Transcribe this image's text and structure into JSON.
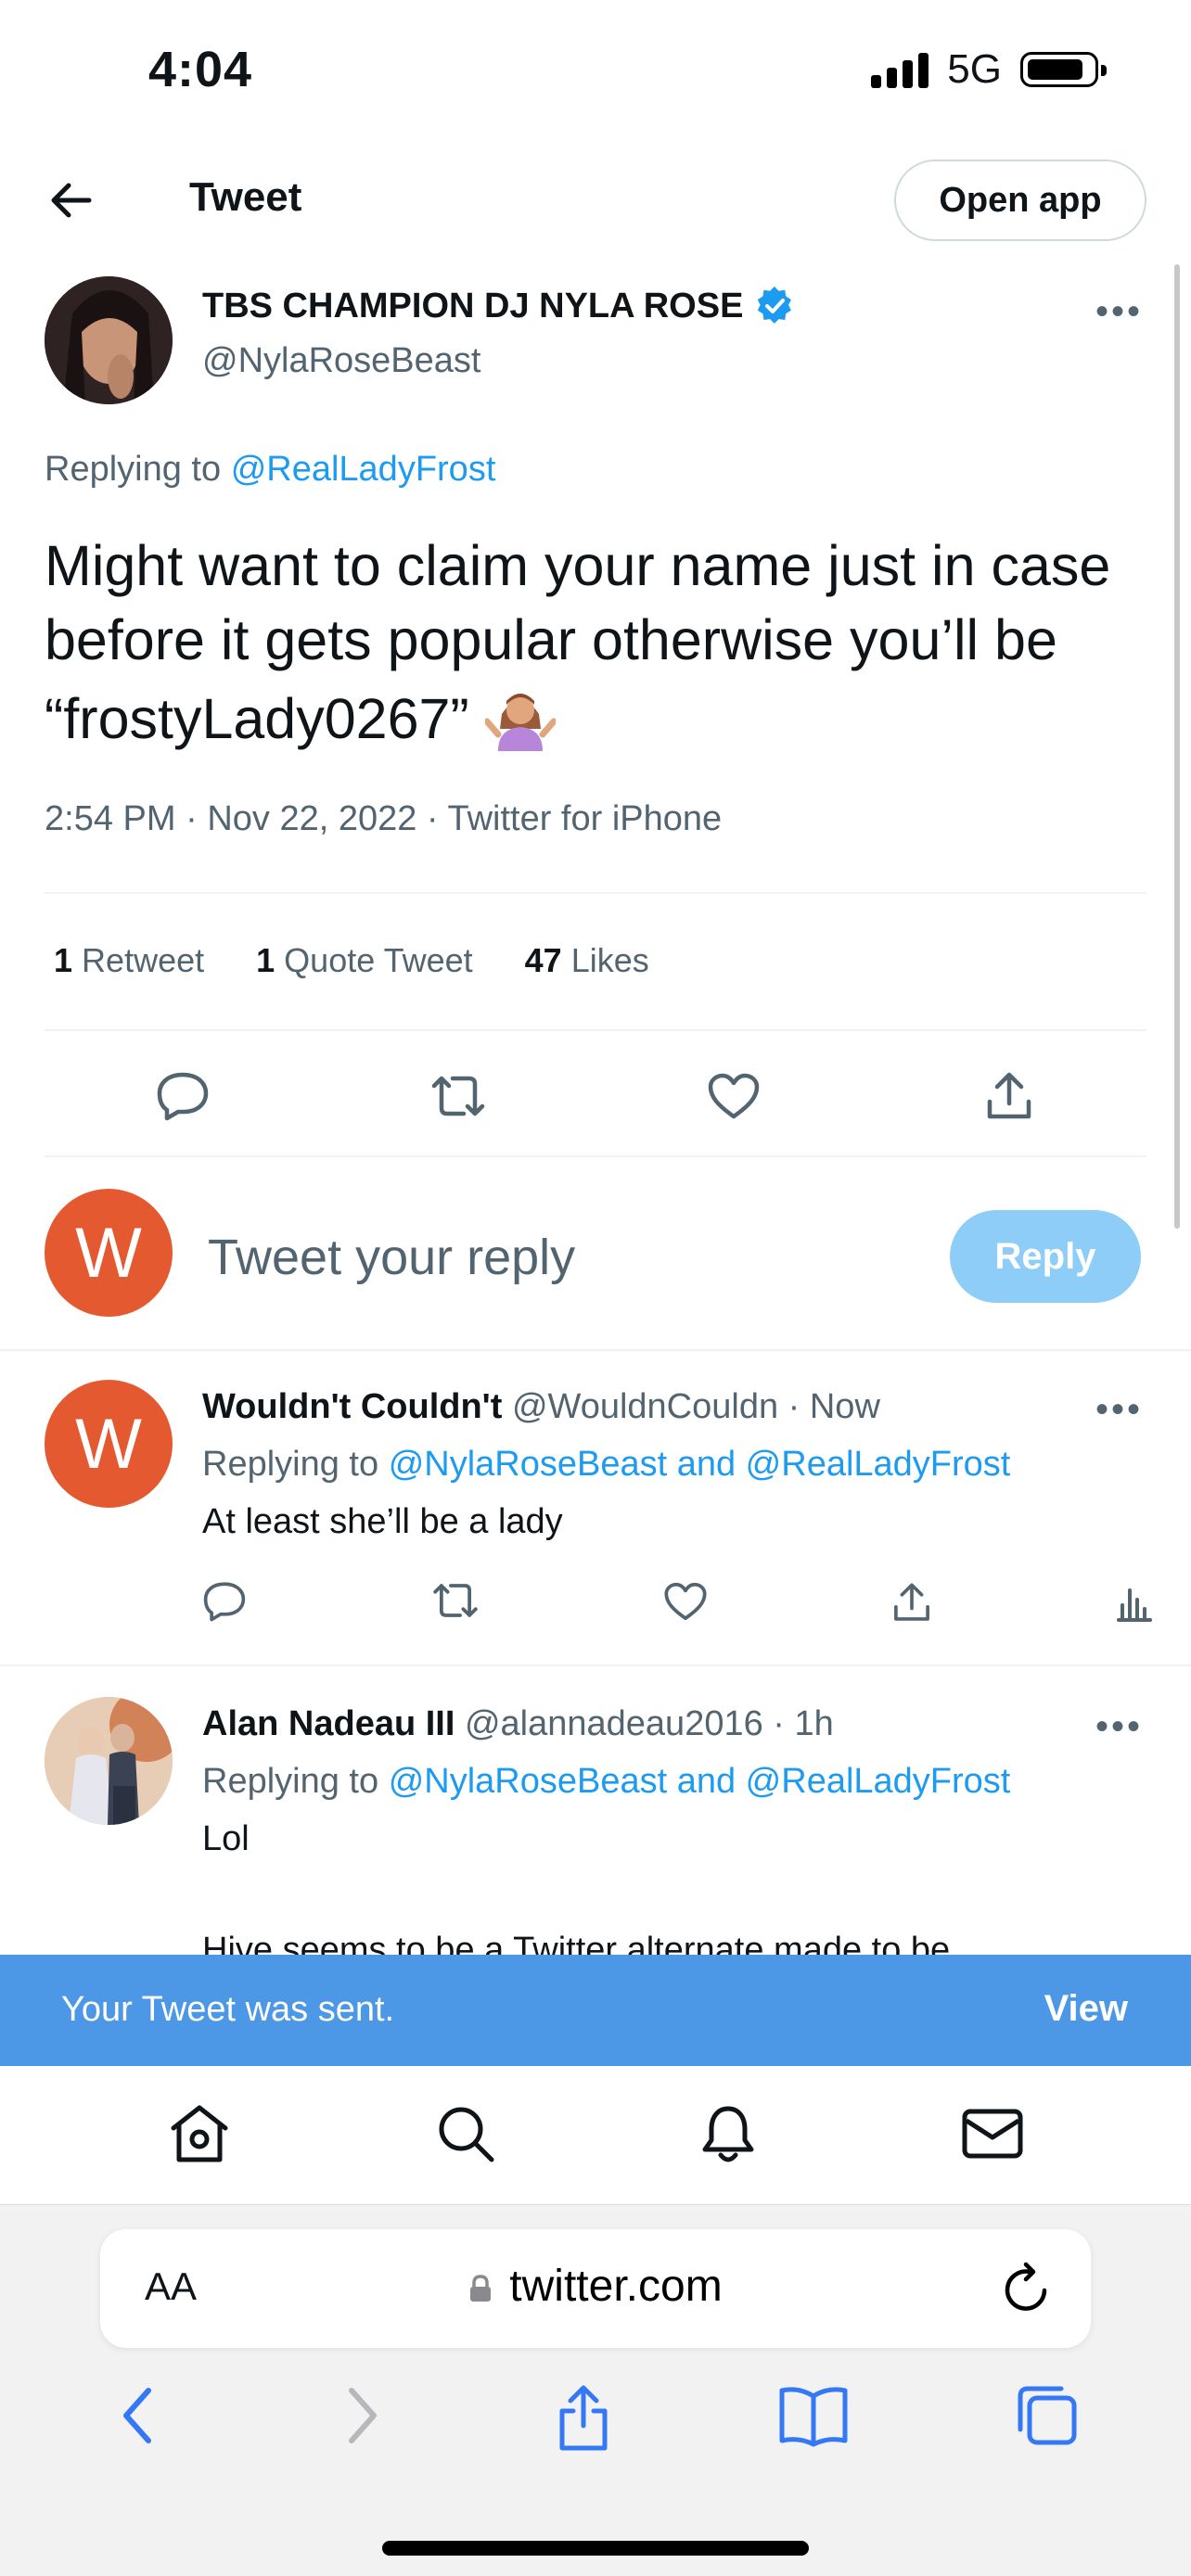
{
  "status_bar": {
    "time": "4:04",
    "network": "5G"
  },
  "header": {
    "title": "Tweet",
    "open_app_label": "Open app"
  },
  "tweet": {
    "display_name": "TBS CHAMPION DJ NYLA ROSE",
    "handle": "@NylaRoseBeast",
    "replying_prefix": "Replying to",
    "replying_to": "@RealLadyFrost",
    "text": "Might want to claim your name just in case before it gets popular otherwise you’ll be “frostyLady0267”",
    "emoji": "person-shrugging-emoji",
    "time": "2:54 PM",
    "date": "Nov 22, 2022",
    "source": "Twitter for iPhone",
    "retweet_count": "1",
    "retweet_label": "Retweet",
    "quote_count": "1",
    "quote_label": "Quote Tweet",
    "likes_count": "47",
    "likes_label": "Likes"
  },
  "compose": {
    "avatar_letter": "W",
    "placeholder": "Tweet your reply",
    "reply_label": "Reply"
  },
  "replies": [
    {
      "avatar_letter": "W",
      "name": "Wouldn't Couldn't",
      "handle": "@WouldnCouldn",
      "time": "· Now",
      "replying_prefix": "Replying to",
      "replying_to": "@NylaRoseBeast and @RealLadyFrost",
      "text": "At least she’ll be a lady"
    },
    {
      "name": "Alan Nadeau III",
      "handle": "@alannadeau2016",
      "time": "· 1h",
      "replying_prefix": "Replying to",
      "replying_to": "@NylaRoseBeast and @RealLadyFrost",
      "text": "Lol",
      "text_more": "Hive seems to be a Twitter alternate made to be"
    }
  ],
  "toast": {
    "message": "Your Tweet was sent.",
    "action": "View"
  },
  "browser": {
    "aa_label": "AA",
    "url": "twitter.com"
  },
  "colors": {
    "accent": "#1d9bf0",
    "toast": "#4c98e6",
    "avatar_orange": "#e4592f",
    "reply_button": "#8ecdf8"
  },
  "icons": {
    "tabbar": [
      "home-icon",
      "search-icon",
      "bell-icon",
      "mail-icon"
    ],
    "browser_nav": [
      "back-icon",
      "forward-icon",
      "share-icon",
      "bookmarks-icon",
      "tabs-icon"
    ]
  }
}
